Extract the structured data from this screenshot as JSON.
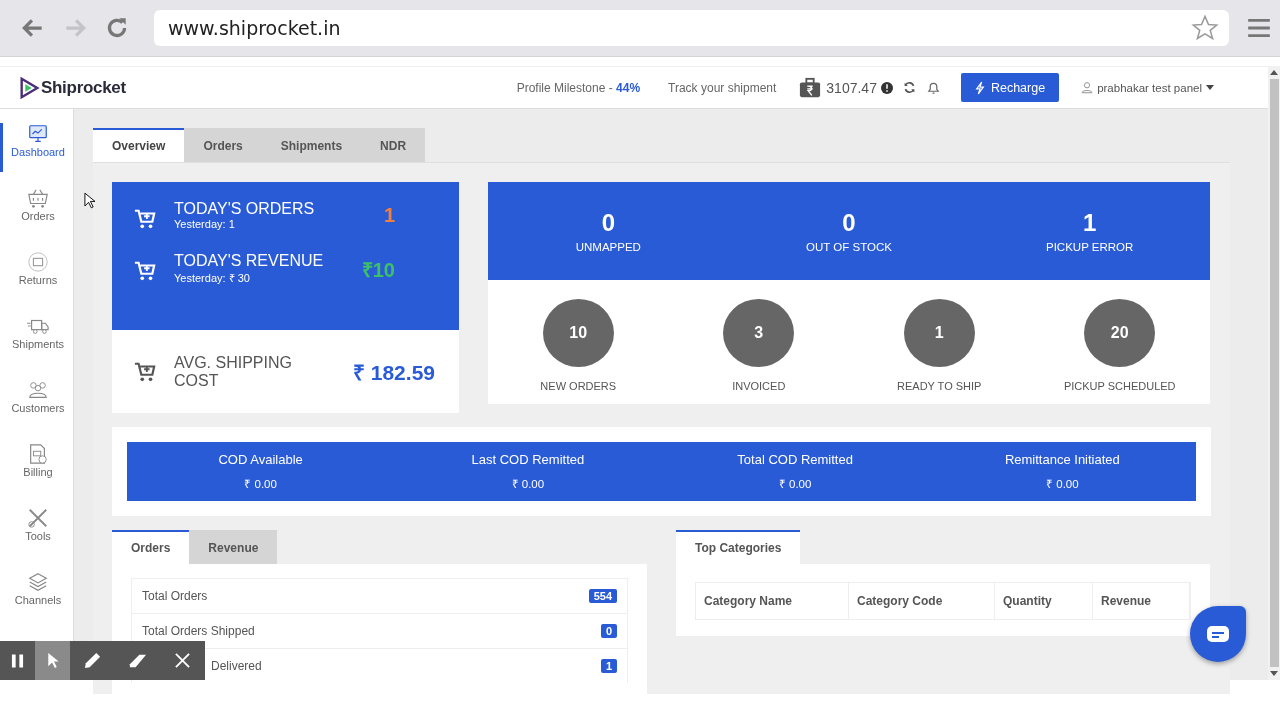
{
  "browser": {
    "url": "www.shiprocket.in"
  },
  "header": {
    "logo": "Shiprocket",
    "milestone_label": "Profile Milestone -",
    "milestone_value": "44%",
    "track": "Track your shipment",
    "wallet": "3107.47",
    "recharge": "Recharge",
    "user": "prabhakar test panel"
  },
  "sidebar": {
    "items": [
      {
        "kind": "dashboard",
        "label": "Dashboard",
        "selected": true
      },
      {
        "kind": "orders",
        "label": "Orders",
        "selected": false
      },
      {
        "kind": "returns",
        "label": "Returns",
        "selected": false
      },
      {
        "kind": "shipments",
        "label": "Shipments",
        "selected": false
      },
      {
        "kind": "customers",
        "label": "Customers",
        "selected": false
      },
      {
        "kind": "billing",
        "label": "Billing",
        "selected": false
      },
      {
        "kind": "tools",
        "label": "Tools",
        "selected": false
      },
      {
        "kind": "channels",
        "label": "Channels",
        "selected": false
      }
    ]
  },
  "tabs": [
    {
      "label": "Overview",
      "selected": true
    },
    {
      "label": "Orders",
      "selected": false
    },
    {
      "label": "Shipments",
      "selected": false
    },
    {
      "label": "NDR",
      "selected": false
    }
  ],
  "today": [
    {
      "title": "TODAY'S ORDERS",
      "sub": "Yesterday: 1",
      "value": "1",
      "color": "#f0803c"
    },
    {
      "title": "TODAY'S REVENUE",
      "sub": "Yesterday:  ₹ 30",
      "value": "₹10",
      "color": "#3cc264"
    }
  ],
  "avg_shipping": {
    "label": "AVG. SHIPPING COST",
    "value": "₹ 182.59"
  },
  "issues": [
    {
      "value": "0",
      "label": "UNMAPPED"
    },
    {
      "value": "0",
      "label": "OUT OF STOCK"
    },
    {
      "value": "1",
      "label": "PICKUP ERROR"
    }
  ],
  "pipeline": [
    {
      "value": "10",
      "label": "NEW ORDERS"
    },
    {
      "value": "3",
      "label": "INVOICED"
    },
    {
      "value": "1",
      "label": "READY TO SHIP"
    },
    {
      "value": "20",
      "label": "PICKUP SCHEDULED"
    }
  ],
  "cod": [
    {
      "label": "COD Available",
      "value": "₹ 0.00"
    },
    {
      "label": "Last COD Remitted",
      "value": "₹ 0.00"
    },
    {
      "label": "Total COD Remitted",
      "value": "₹ 0.00"
    },
    {
      "label": "Remittance Initiated",
      "value": "₹ 0.00"
    }
  ],
  "order_tabs": [
    {
      "label": "Orders",
      "selected": true
    },
    {
      "label": "Revenue",
      "selected": false
    }
  ],
  "order_stats": [
    {
      "label": "Total Orders",
      "count": "554",
      "covered": false
    },
    {
      "label": "Total Orders Shipped",
      "count": "0",
      "covered": false
    },
    {
      "label": "Delivered",
      "count": "1",
      "covered": true
    }
  ],
  "categories": {
    "tab": "Top Categories",
    "columns": [
      "Category Name",
      "Category Code",
      "Quantity",
      "Revenue"
    ]
  }
}
